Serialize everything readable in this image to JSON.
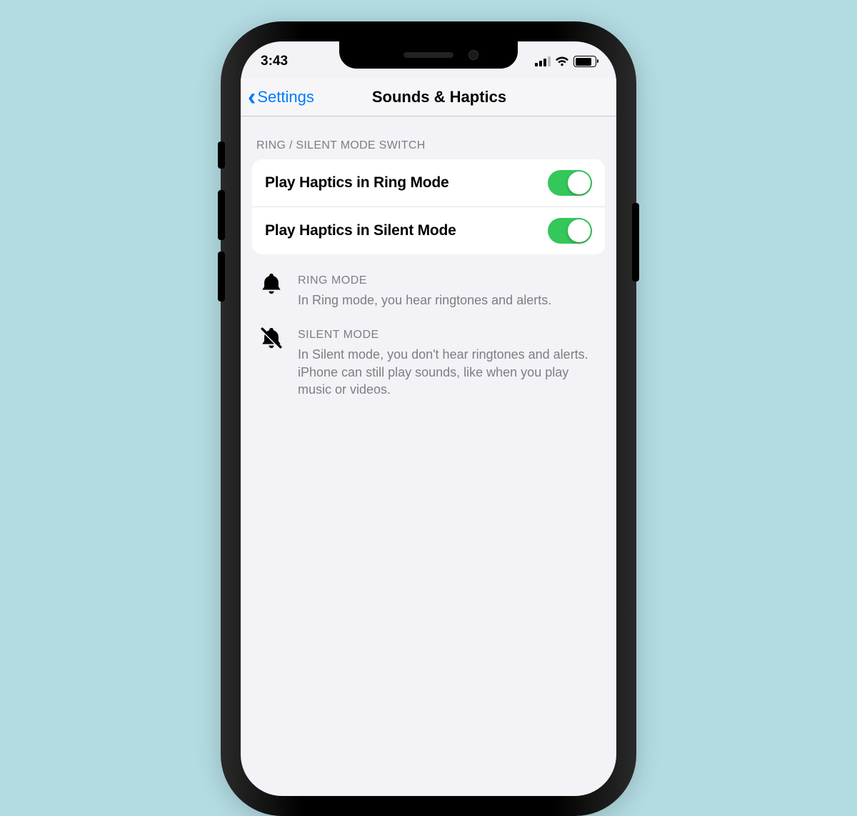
{
  "status": {
    "time": "3:43"
  },
  "nav": {
    "back_label": "Settings",
    "title": "Sounds & Haptics"
  },
  "section": {
    "header": "RING / SILENT MODE SWITCH",
    "row1_label": "Play Haptics in Ring Mode",
    "row1_on": true,
    "row2_label": "Play Haptics in Silent Mode",
    "row2_on": true
  },
  "info1": {
    "title": "RING MODE",
    "body": "In Ring mode, you hear ringtones and alerts."
  },
  "info2": {
    "title": "SILENT MODE",
    "body": "In Silent mode, you don't hear ringtones and alerts. iPhone can still play sounds, like when you play music or videos."
  },
  "colors": {
    "accent": "#007aff",
    "toggle_on": "#34c759"
  }
}
